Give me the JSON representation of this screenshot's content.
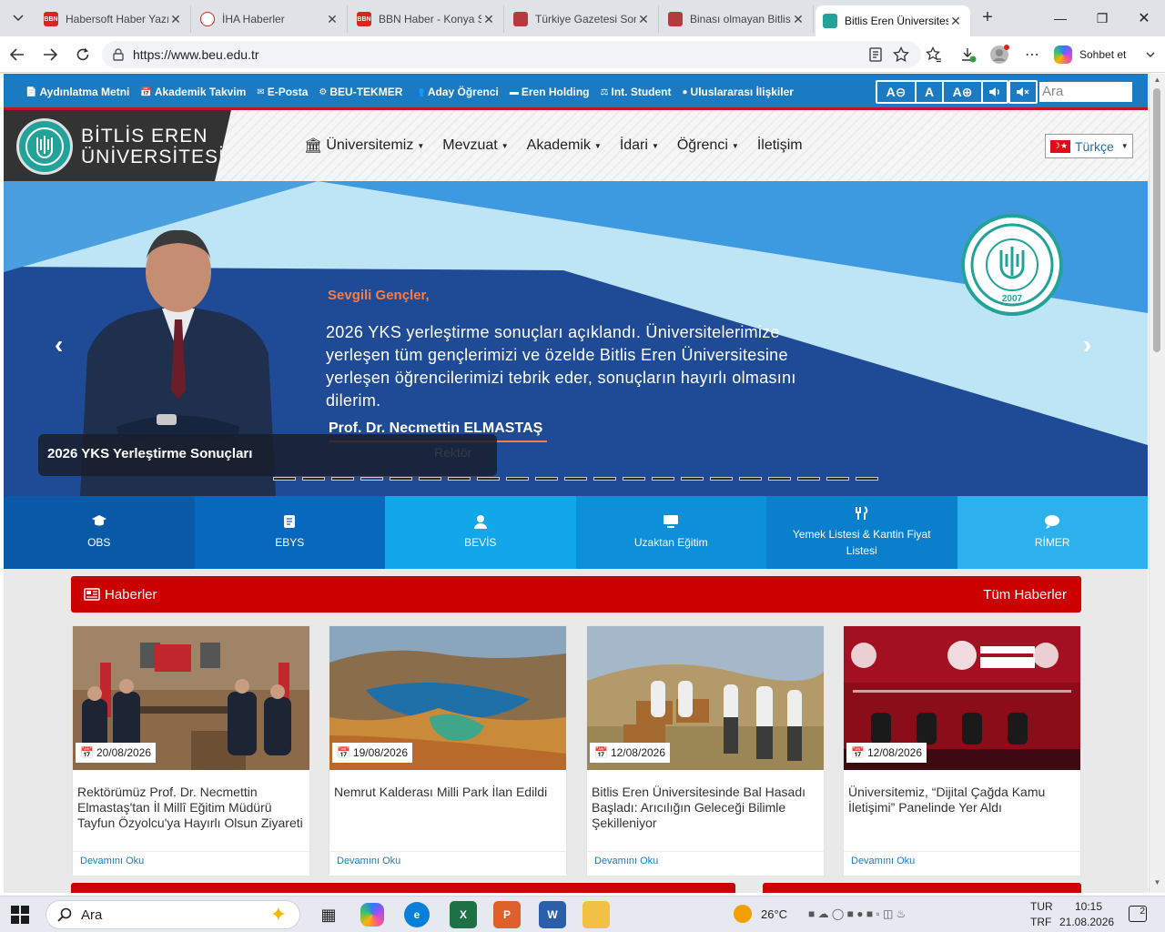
{
  "browser": {
    "tabs": [
      {
        "title": "Habersoft Haber Yazı",
        "fav": "BBN",
        "color": "#d9261c"
      },
      {
        "title": "İHA Haberler",
        "fav": "",
        "color": "#ffffff"
      },
      {
        "title": "BBN Haber - Konya Sı",
        "fav": "BBN",
        "color": "#d9261c"
      },
      {
        "title": "Türkiye Gazetesi Son",
        "fav": "",
        "color": "#b43b3b"
      },
      {
        "title": "Binası olmayan Bitlis",
        "fav": "",
        "color": "#b43b3b"
      },
      {
        "title": "Bitlis Eren Üniversites",
        "fav": "",
        "color": "#21a39a"
      }
    ],
    "url": "https://www.beu.edu.tr",
    "copilot_label": "Sohbet et"
  },
  "site": {
    "toplinks": [
      "Aydınlatma Metni",
      "Akademik Takvim",
      "E-Posta",
      "BEU-TEKMER",
      "Aday Öğrenci",
      "Eren Holding",
      "Int. Student",
      "Uluslararası İlişkiler"
    ],
    "acc": {
      "dec": "A",
      "normal": "A",
      "inc": "A"
    },
    "search_placeholder": "Ara",
    "logo_line1": "BİTLİS EREN",
    "logo_line2": "ÜNİVERSİTESİ",
    "nav": [
      "Üniversitemiz",
      "Mevzuat",
      "Akademik",
      "İdari",
      "Öğrenci",
      "İletişim"
    ],
    "lang": "Türkçe",
    "slide": {
      "greeting": "Sevgili Gençler,",
      "text": "2026 YKS yerleştirme sonuçları açıklandı. Üniversitelerimize yerleşen tüm gençlerimizi ve özelde Bitlis Eren Üniversitesine yerleşen öğrencilerimizi tebrik eder, sonuçların hayırlı olmasını dilerim.",
      "name": "Prof. Dr. Necmettin ELMASTAŞ",
      "role": "Rektör",
      "logo_year": "2007",
      "caption": "2026 YKS Yerleştirme Sonuçları",
      "dot_count": 21,
      "active_dot": 3
    },
    "quick": [
      {
        "label": "OBS",
        "color": "#0b5aa8"
      },
      {
        "label": "EBYS",
        "color": "#0868bd"
      },
      {
        "label": "BEVİS",
        "color": "#12a7e8"
      },
      {
        "label": "Uzaktan Eğitim",
        "color": "#0d8fd9"
      },
      {
        "label": "Yemek Listesi & Kantin Fiyat Listesi",
        "color": "#0a80cc"
      },
      {
        "label": "RİMER",
        "color": "#2db1ec"
      }
    ],
    "news": {
      "title": "Haberler",
      "all": "Tüm Haberler",
      "more": "Devamını Oku",
      "items": [
        {
          "date": "20/08/2026",
          "title": "Rektörümüz Prof. Dr. Necmettin Elmastaş'tan İl Millî Eğitim Müdürü Tayfun Özyolcu'ya Hayırlı Olsun Ziyareti"
        },
        {
          "date": "19/08/2026",
          "title": "Nemrut Kalderası Milli Park İlan Edildi"
        },
        {
          "date": "12/08/2026",
          "title": "Bitlis Eren Üniversitesinde Bal Hasadı Başladı: Arıcılığın Geleceği Bilimle Şekilleniyor"
        },
        {
          "date": "12/08/2026",
          "title": "Üniversitemiz, “Dijital Çağda Kamu İletişimi” Panelinde Yer Aldı"
        }
      ]
    }
  },
  "taskbar": {
    "search": "Ara",
    "weather": "26°C",
    "lang1": "TUR",
    "lang2": "TRF",
    "time": "10:15",
    "date": "21.08.2026",
    "notif": "2"
  }
}
